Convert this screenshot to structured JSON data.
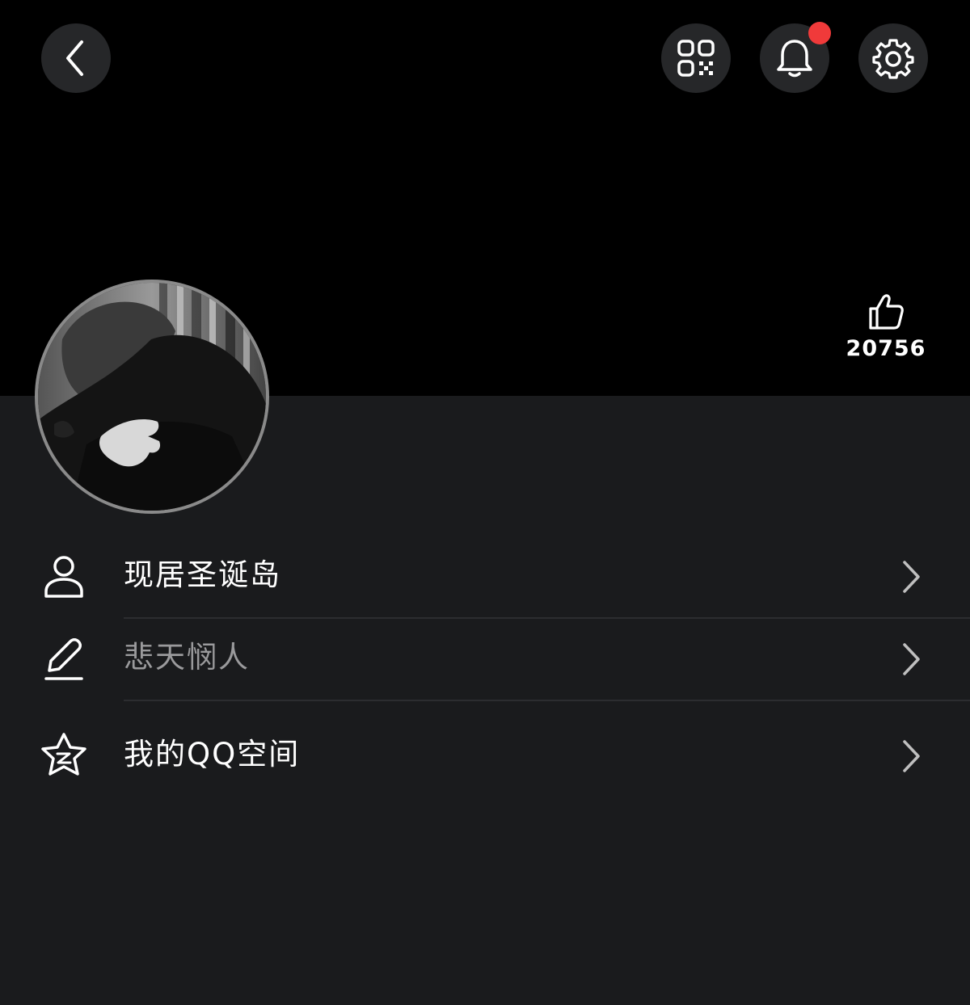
{
  "header": {
    "back_icon": "chevron-left-icon",
    "qr_icon": "qr-code-icon",
    "bell_icon": "bell-icon",
    "settings_icon": "gear-icon",
    "notification_dot_color": "#f03a3a"
  },
  "profile": {
    "likes": "20756",
    "like_icon": "thumbs-up-icon"
  },
  "rows": [
    {
      "icon": "person-icon",
      "text": "现居圣诞岛"
    },
    {
      "icon": "pencil-icon",
      "text": "悲天悯人"
    },
    {
      "icon": "star-icon",
      "text": "我的QQ空间"
    }
  ],
  "colors": {
    "cover": "#000000",
    "background": "#1a1b1d",
    "button": "#262729",
    "muted_text": "#9a9a9c"
  }
}
